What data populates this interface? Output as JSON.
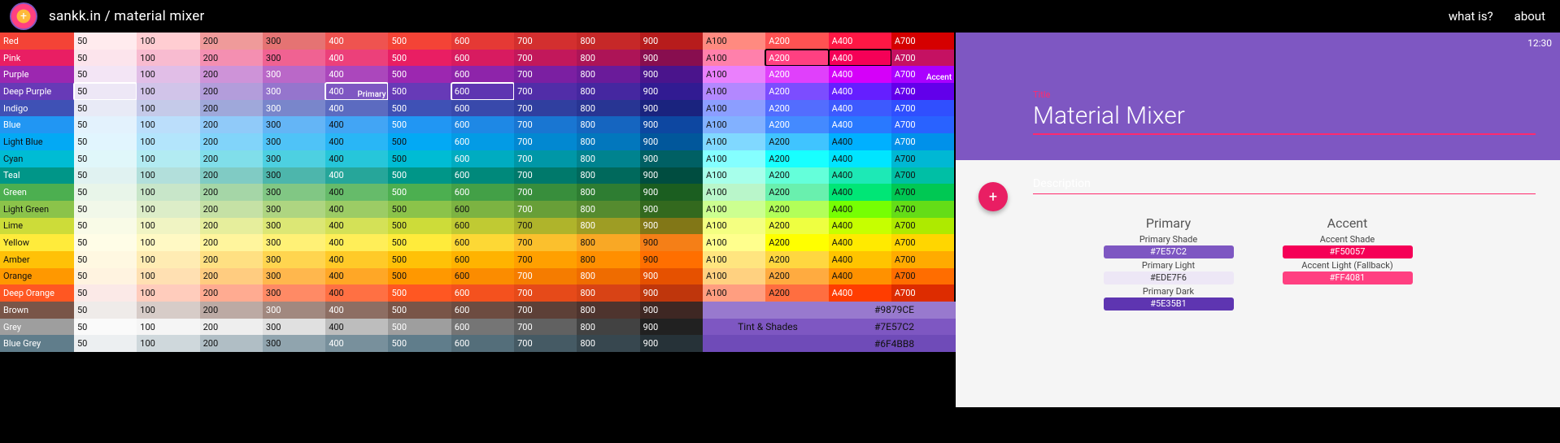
{
  "header": {
    "brand": "sankk.in / material mixer",
    "links": [
      "what is?",
      "about"
    ]
  },
  "preview": {
    "clock": "12:30",
    "title_label": "Title",
    "title": "Material Mixer",
    "description_label": "Description",
    "fab_glyph": "+",
    "primary_header": "Primary",
    "accent_header": "Accent",
    "primary_shade_label": "Primary Shade",
    "primary_shade_value": "#7E57C2",
    "primary_light_label": "Primary Light",
    "primary_light_value": "#EDE7F6",
    "primary_dark_label": "Primary Dark",
    "primary_dark_value": "#5E35B1",
    "accent_shade_label": "Accent Shade",
    "accent_shade_value": "#F50057",
    "accent_light_label": "Accent Light (Fallback)",
    "accent_light_value": "#FF4081"
  },
  "tint": {
    "label": "Tint & Shades",
    "rows": [
      "#9879CE",
      "#7E57C2",
      "#6F4BB8"
    ]
  },
  "selection": {
    "primary_row": 3,
    "primary_col": 4,
    "primary_label": "Primary",
    "primary_row2": 3,
    "primary_col2": 0,
    "primary_row3": 3,
    "primary_col3": 6,
    "accent_row": 1,
    "accent_col": 11,
    "accent_row_b": 1,
    "accent_col_b": 12,
    "accent_label": "Accent"
  },
  "shade_labels": [
    "50",
    "100",
    "200",
    "300",
    "400",
    "500",
    "600",
    "700",
    "800",
    "900",
    "A100",
    "A200",
    "A400",
    "A700"
  ],
  "colors": [
    {
      "name": "Red",
      "shades": [
        "#FFEBEE",
        "#FFCDD2",
        "#EF9A9A",
        "#E57373",
        "#EF5350",
        "#F44336",
        "#E53935",
        "#D32F2F",
        "#C62828",
        "#B71C1C",
        "#FF8A80",
        "#FF5252",
        "#FF1744",
        "#D50000"
      ],
      "tc": [
        0,
        0,
        0,
        0,
        1,
        1,
        1,
        1,
        1,
        1,
        0,
        1,
        1,
        1
      ]
    },
    {
      "name": "Pink",
      "shades": [
        "#FCE4EC",
        "#F8BBD0",
        "#F48FB1",
        "#F06292",
        "#EC407A",
        "#E91E63",
        "#D81B60",
        "#C2185B",
        "#AD1457",
        "#880E4F",
        "#FF80AB",
        "#FF4081",
        "#F50057",
        "#C51162"
      ],
      "tc": [
        0,
        0,
        0,
        0,
        1,
        1,
        1,
        1,
        1,
        1,
        0,
        1,
        1,
        1
      ]
    },
    {
      "name": "Purple",
      "shades": [
        "#F3E5F5",
        "#E1BEE7",
        "#CE93D8",
        "#BA68C8",
        "#AB47BC",
        "#9C27B0",
        "#8E24AA",
        "#7B1FA2",
        "#6A1B9A",
        "#4A148C",
        "#EA80FC",
        "#E040FB",
        "#D500F9",
        "#AA00FF"
      ],
      "tc": [
        0,
        0,
        0,
        1,
        1,
        1,
        1,
        1,
        1,
        1,
        0,
        1,
        1,
        1
      ]
    },
    {
      "name": "Deep Purple",
      "shades": [
        "#EDE7F6",
        "#D1C4E9",
        "#B39DDB",
        "#9575CD",
        "#7E57C2",
        "#673AB7",
        "#5E35B1",
        "#512DA8",
        "#4527A0",
        "#311B92",
        "#B388FF",
        "#7C4DFF",
        "#651FFF",
        "#6200EA"
      ],
      "tc": [
        0,
        0,
        0,
        1,
        1,
        1,
        1,
        1,
        1,
        1,
        0,
        1,
        1,
        1
      ]
    },
    {
      "name": "Indigo",
      "shades": [
        "#E8EAF6",
        "#C5CAE9",
        "#9FA8DA",
        "#7986CB",
        "#5C6BC0",
        "#3F51B5",
        "#3949AB",
        "#303F9F",
        "#283593",
        "#1A237E",
        "#8C9EFF",
        "#536DFE",
        "#3D5AFE",
        "#304FFE"
      ],
      "tc": [
        0,
        0,
        0,
        1,
        1,
        1,
        1,
        1,
        1,
        1,
        0,
        1,
        1,
        1
      ]
    },
    {
      "name": "Blue",
      "shades": [
        "#E3F2FD",
        "#BBDEFB",
        "#90CAF9",
        "#64B5F6",
        "#42A5F5",
        "#2196F3",
        "#1E88E5",
        "#1976D2",
        "#1565C0",
        "#0D47A1",
        "#82B1FF",
        "#448AFF",
        "#2979FF",
        "#2962FF"
      ],
      "tc": [
        0,
        0,
        0,
        0,
        0,
        1,
        1,
        1,
        1,
        1,
        0,
        1,
        1,
        1
      ]
    },
    {
      "name": "Light Blue",
      "shades": [
        "#E1F5FE",
        "#B3E5FC",
        "#81D4FA",
        "#4FC3F7",
        "#29B6F6",
        "#03A9F4",
        "#039BE5",
        "#0288D1",
        "#0277BD",
        "#01579B",
        "#80D8FF",
        "#40C4FF",
        "#00B0FF",
        "#0091EA"
      ],
      "tc": [
        0,
        0,
        0,
        0,
        0,
        0,
        1,
        1,
        1,
        1,
        0,
        0,
        0,
        1
      ]
    },
    {
      "name": "Cyan",
      "shades": [
        "#E0F7FA",
        "#B2EBF2",
        "#80DEEA",
        "#4DD0E1",
        "#26C6DA",
        "#00BCD4",
        "#00ACC1",
        "#0097A7",
        "#00838F",
        "#006064",
        "#84FFFF",
        "#18FFFF",
        "#00E5FF",
        "#00B8D4"
      ],
      "tc": [
        0,
        0,
        0,
        0,
        0,
        0,
        1,
        1,
        1,
        1,
        0,
        0,
        0,
        0
      ]
    },
    {
      "name": "Teal",
      "shades": [
        "#E0F2F1",
        "#B2DFDB",
        "#80CBC4",
        "#4DB6AC",
        "#26A69A",
        "#009688",
        "#00897B",
        "#00796B",
        "#00695C",
        "#004D40",
        "#A7FFEB",
        "#64FFDA",
        "#1DE9B6",
        "#00BFA5"
      ],
      "tc": [
        0,
        0,
        0,
        0,
        1,
        1,
        1,
        1,
        1,
        1,
        0,
        0,
        0,
        0
      ]
    },
    {
      "name": "Green",
      "shades": [
        "#E8F5E9",
        "#C8E6C9",
        "#A5D6A7",
        "#81C784",
        "#66BB6A",
        "#4CAF50",
        "#43A047",
        "#388E3C",
        "#2E7D32",
        "#1B5E20",
        "#B9F6CA",
        "#69F0AE",
        "#00E676",
        "#00C853"
      ],
      "tc": [
        0,
        0,
        0,
        0,
        0,
        1,
        1,
        1,
        1,
        1,
        0,
        0,
        0,
        0
      ]
    },
    {
      "name": "Light Green",
      "shades": [
        "#F1F8E9",
        "#DCEDC8",
        "#C5E1A5",
        "#AED581",
        "#9CCC65",
        "#8BC34A",
        "#7CB342",
        "#689F38",
        "#558B2F",
        "#33691E",
        "#CCFF90",
        "#B2FF59",
        "#76FF03",
        "#64DD17"
      ],
      "tc": [
        0,
        0,
        0,
        0,
        0,
        0,
        0,
        1,
        1,
        1,
        0,
        0,
        0,
        0
      ]
    },
    {
      "name": "Lime",
      "shades": [
        "#F9FBE7",
        "#F0F4C3",
        "#E6EE9C",
        "#DCE775",
        "#D4E157",
        "#CDDC39",
        "#C0CA33",
        "#AFB42B",
        "#9E9D24",
        "#827717",
        "#F4FF81",
        "#EEFF41",
        "#C6FF00",
        "#AEEA00"
      ],
      "tc": [
        0,
        0,
        0,
        0,
        0,
        0,
        0,
        0,
        1,
        1,
        0,
        0,
        0,
        0
      ]
    },
    {
      "name": "Yellow",
      "shades": [
        "#FFFDE7",
        "#FFF9C4",
        "#FFF59D",
        "#FFF176",
        "#FFEE58",
        "#FFEB3B",
        "#FDD835",
        "#FBC02D",
        "#F9A825",
        "#F57F17",
        "#FFFF8D",
        "#FFFF00",
        "#FFEA00",
        "#FFD600"
      ],
      "tc": [
        0,
        0,
        0,
        0,
        0,
        0,
        0,
        0,
        0,
        0,
        0,
        0,
        0,
        0
      ]
    },
    {
      "name": "Amber",
      "shades": [
        "#FFF8E1",
        "#FFECB3",
        "#FFE082",
        "#FFD54F",
        "#FFCA28",
        "#FFC107",
        "#FFB300",
        "#FFA000",
        "#FF8F00",
        "#FF6F00",
        "#FFE57F",
        "#FFD740",
        "#FFC400",
        "#FFAB00"
      ],
      "tc": [
        0,
        0,
        0,
        0,
        0,
        0,
        0,
        0,
        0,
        0,
        0,
        0,
        0,
        0
      ]
    },
    {
      "name": "Orange",
      "shades": [
        "#FFF3E0",
        "#FFE0B2",
        "#FFCC80",
        "#FFB74D",
        "#FFA726",
        "#FF9800",
        "#FB8C00",
        "#F57C00",
        "#EF6C00",
        "#E65100",
        "#FFD180",
        "#FFAB40",
        "#FF9100",
        "#FF6D00"
      ],
      "tc": [
        0,
        0,
        0,
        0,
        0,
        0,
        0,
        1,
        1,
        1,
        0,
        0,
        0,
        0
      ]
    },
    {
      "name": "Deep Orange",
      "shades": [
        "#FBE9E7",
        "#FFCCBC",
        "#FFAB91",
        "#FF8A65",
        "#FF7043",
        "#FF5722",
        "#F4511E",
        "#E64A19",
        "#D84315",
        "#BF360C",
        "#FF9E80",
        "#FF6E40",
        "#FF3D00",
        "#DD2C00"
      ],
      "tc": [
        0,
        0,
        0,
        0,
        0,
        1,
        1,
        1,
        1,
        1,
        0,
        0,
        1,
        1
      ]
    },
    {
      "name": "Brown",
      "shades": [
        "#EFEBE9",
        "#D7CCC8",
        "#BCAAA4",
        "#A1887F",
        "#8D6E63",
        "#795548",
        "#6D4C41",
        "#5D4037",
        "#4E342E",
        "#3E2723"
      ],
      "tc": [
        0,
        0,
        0,
        1,
        1,
        1,
        1,
        1,
        1,
        1
      ]
    },
    {
      "name": "Grey",
      "shades": [
        "#FAFAFA",
        "#F5F5F5",
        "#EEEEEE",
        "#E0E0E0",
        "#BDBDBD",
        "#9E9E9E",
        "#757575",
        "#616161",
        "#424242",
        "#212121"
      ],
      "tc": [
        0,
        0,
        0,
        0,
        0,
        1,
        1,
        1,
        1,
        1
      ]
    },
    {
      "name": "Blue Grey",
      "shades": [
        "#ECEFF1",
        "#CFD8DC",
        "#B0BEC5",
        "#90A4AE",
        "#78909C",
        "#607D8B",
        "#546E7A",
        "#455A64",
        "#37474F",
        "#263238"
      ],
      "tc": [
        0,
        0,
        0,
        0,
        1,
        1,
        1,
        1,
        1,
        1
      ]
    }
  ]
}
